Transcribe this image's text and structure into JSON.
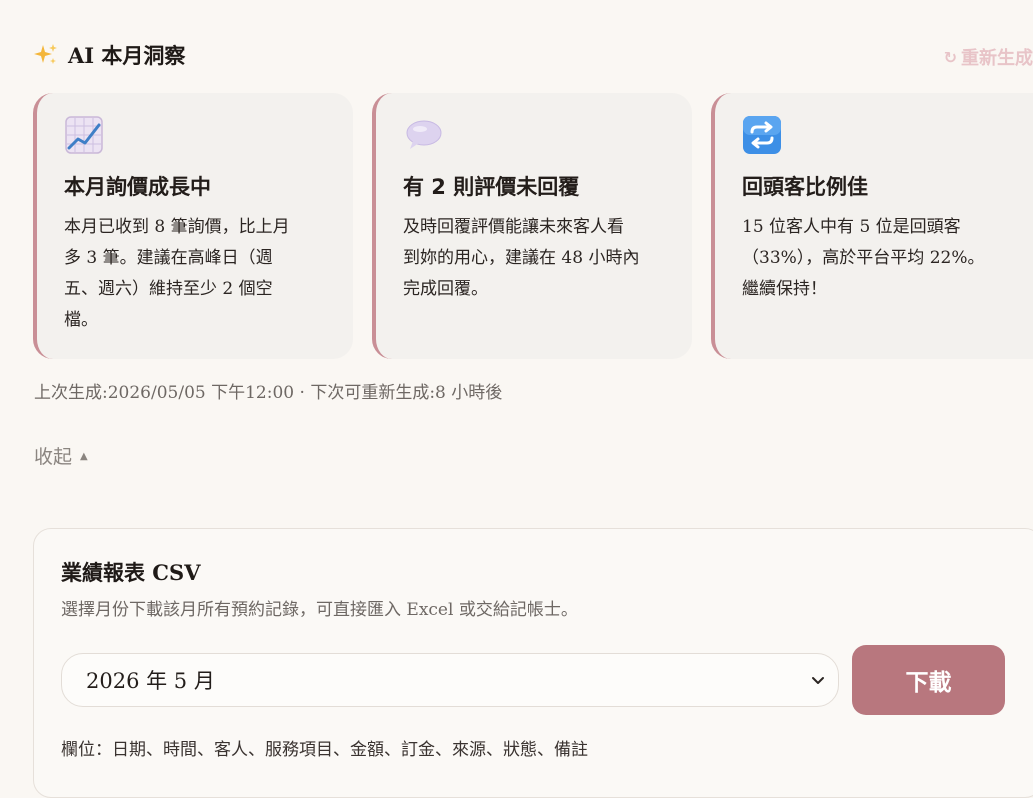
{
  "insights": {
    "title": "AI 本月洞察",
    "regenerate_label": "重新生成",
    "cards": [
      {
        "icon": "chart-increasing-icon",
        "title": "本月詢價成長中",
        "body": "本月已收到 8 筆詢價，比上月\n多 3 筆。建議在高峰日（週\n五、週六）維持至少 2 個空\n檔。"
      },
      {
        "icon": "speech-bubble-icon",
        "title": "有 2 則評價未回覆",
        "body": "及時回覆評價能讓未來客人看\n到妳的用心，建議在 48 小時內\n完成回覆。"
      },
      {
        "icon": "repeat-icon",
        "title": "回頭客比例佳",
        "body": "15 位客人中有 5 位是回頭客\n（33%），高於平台平均 22%。\n繼續保持！"
      }
    ],
    "meta": "上次生成:2026/05/05 下午12:00 · 下次可重新生成:8 小時後",
    "collapse_label": "收起"
  },
  "report": {
    "title": "業績報表 CSV",
    "description": "選擇月份下載該月所有預約記錄，可直接匯入 Excel 或交給記帳士。",
    "selected_month": "2026 年 5 月",
    "download_label": "下載",
    "fields_text": "欄位：日期、時間、客人、服務項目、金額、訂金、來源、狀態、備註"
  },
  "colors": {
    "accent": "#c98f96",
    "button": "#b8777e",
    "background": "#faf7f3",
    "card": "#f3f1ee"
  }
}
